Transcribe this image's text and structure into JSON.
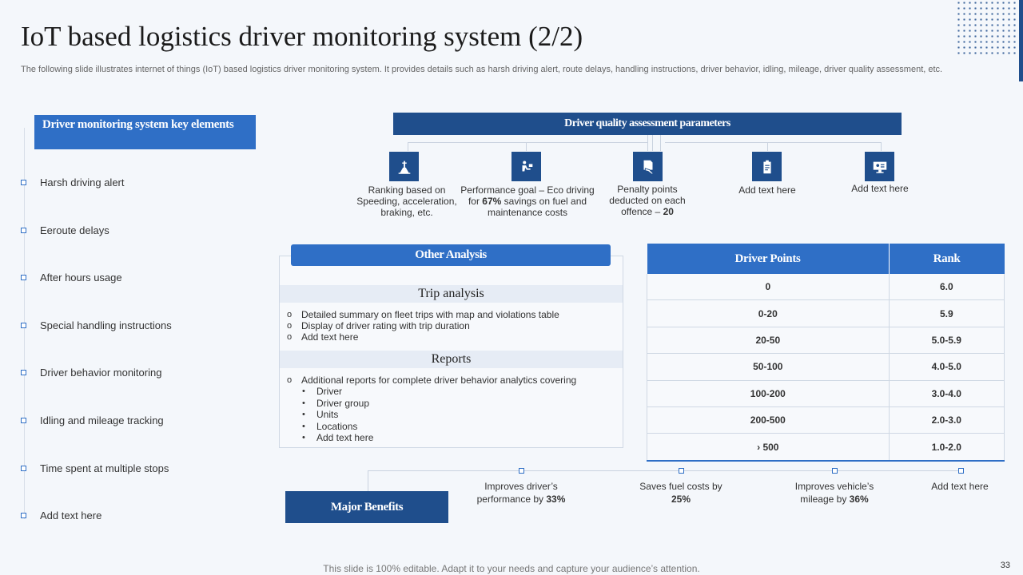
{
  "title": "IoT based logistics driver monitoring system (2/2)",
  "subtitle": "The following slide illustrates internet of things (IoT) based logistics driver monitoring system. It provides details such as harsh driving alert, route delays, handling instructions, driver behavior, idling, mileage, driver quality assessment, etc.",
  "left_panel": {
    "header": "Driver monitoring system key elements",
    "items": [
      "Harsh driving  alert",
      "Eeroute delays",
      "After hours usage",
      "Special handling instructions",
      "Driver  behavior  monitoring",
      "Idling and mileage tracking",
      "Time spent at multiple stops",
      "Add text here"
    ]
  },
  "quality": {
    "header": "Driver quality assessment parameters",
    "params": [
      {
        "icon": "road-icon",
        "pre": "Ranking based on Speeding, acceleration, braking, etc.",
        "bold": "",
        "post": ""
      },
      {
        "icon": "driver-icon",
        "pre": "Performance goal – Eco driving for ",
        "bold": "67%",
        "post": "  savings on fuel and maintenance costs"
      },
      {
        "icon": "penalty-icon",
        "pre": "Penalty points deducted on each offence – ",
        "bold": "20",
        "post": ""
      },
      {
        "icon": "clipboard-icon",
        "pre": "Add text here",
        "bold": "",
        "post": ""
      },
      {
        "icon": "monitor-icon",
        "pre": "Add text here",
        "bold": "",
        "post": ""
      }
    ]
  },
  "other_analysis": {
    "header": "Other Analysis",
    "trip_title": "Trip analysis",
    "trip_items": [
      "Detailed summary on fleet trips with map and violations table",
      "Display of driver rating with trip duration",
      "Add text here"
    ],
    "reports_title": "Reports",
    "reports_intro": "Additional reports for complete driver behavior analytics covering",
    "reports_items": [
      "Driver",
      "Driver group",
      "Units",
      "Locations",
      "Add text here"
    ],
    "circle_marker": "o",
    "bullet_marker": "•"
  },
  "points_table": {
    "headers": [
      "Driver Points",
      "Rank"
    ],
    "rows": [
      [
        "0",
        "6.0"
      ],
      [
        "0-20",
        "5.9"
      ],
      [
        "20-50",
        "5.0-5.9"
      ],
      [
        "50-100",
        "4.0-5.0"
      ],
      [
        "100-200",
        "3.0-4.0"
      ],
      [
        "200-500",
        "2.0-3.0"
      ],
      [
        "›    500",
        "1.0-2.0"
      ]
    ]
  },
  "benefits": {
    "header": "Major Benefits",
    "items": [
      {
        "pre": "Improves  driver’s performance  by ",
        "bold": "33%"
      },
      {
        "pre": "Saves fuel costs by ",
        "bold": "25%"
      },
      {
        "pre": "Improves  vehicle’s mileage  by ",
        "bold": "36%"
      },
      {
        "pre": "Add text here",
        "bold": ""
      }
    ]
  },
  "footer": "This slide is 100% editable. Adapt it to your needs and capture your audience’s attention.",
  "page_number": "33",
  "colors": {
    "primary": "#1f4e8c",
    "accent": "#2f6fc6",
    "background": "#f4f7fb"
  }
}
